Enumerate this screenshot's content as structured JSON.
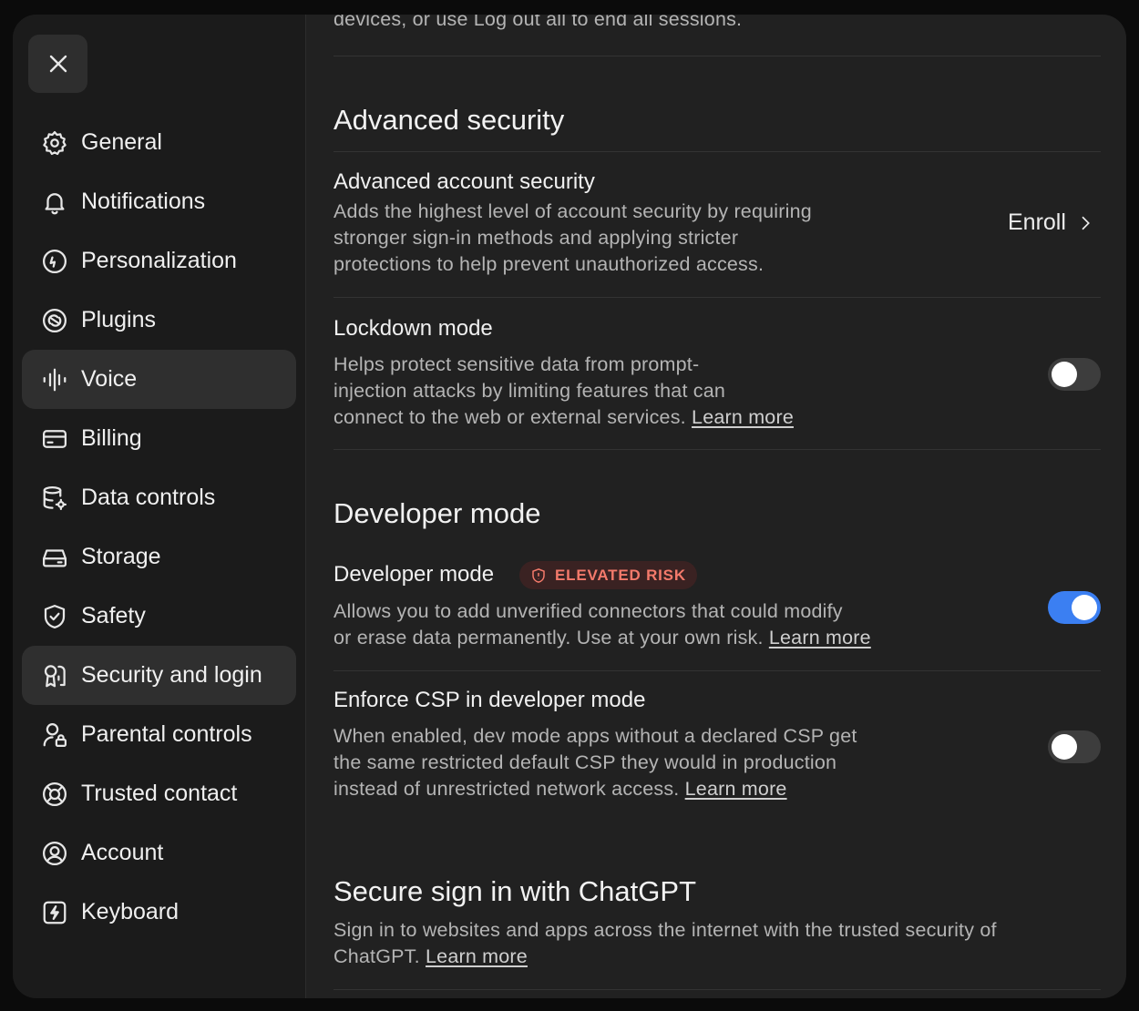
{
  "sidebar": {
    "items": [
      {
        "label": "General",
        "icon": "gear-icon",
        "active": false
      },
      {
        "label": "Notifications",
        "icon": "bell-icon",
        "active": false
      },
      {
        "label": "Personalization",
        "icon": "personalization-icon",
        "active": false
      },
      {
        "label": "Plugins",
        "icon": "plugins-icon",
        "active": false
      },
      {
        "label": "Voice",
        "icon": "waveform-icon",
        "active": true
      },
      {
        "label": "Billing",
        "icon": "credit-card-icon",
        "active": false
      },
      {
        "label": "Data controls",
        "icon": "database-gear-icon",
        "active": false
      },
      {
        "label": "Storage",
        "icon": "hard-drive-icon",
        "active": false
      },
      {
        "label": "Safety",
        "icon": "shield-check-icon",
        "active": false
      },
      {
        "label": "Security and login",
        "icon": "key-person-icon",
        "active": true
      },
      {
        "label": "Parental controls",
        "icon": "person-lock-icon",
        "active": false
      },
      {
        "label": "Trusted contact",
        "icon": "lifebuoy-icon",
        "active": false
      },
      {
        "label": "Account",
        "icon": "user-circle-icon",
        "active": false
      },
      {
        "label": "Keyboard",
        "icon": "keyboard-bolt-icon",
        "active": false
      }
    ]
  },
  "content": {
    "top_text": "devices, or use Log out all to end all sessions.",
    "advanced_security": {
      "title": "Advanced security",
      "account": {
        "title": "Advanced account security",
        "desc_lines": [
          "Adds the highest level of account security by requiring",
          "stronger sign-in methods and applying stricter",
          "protections to help prevent unauthorized access."
        ],
        "action": "Enroll"
      },
      "lockdown": {
        "title": "Lockdown mode",
        "desc_lines": [
          "Helps protect sensitive data from prompt-",
          "injection attacks by limiting features that can",
          "connect to the web or external services."
        ],
        "link": "Learn more",
        "enabled": false
      }
    },
    "developer": {
      "title": "Developer mode",
      "mode": {
        "title": "Developer mode",
        "badge": "ELEVATED RISK",
        "desc_lines": [
          "Allows you to add unverified connectors that could modify",
          "or erase data permanently. Use at your own risk."
        ],
        "link": "Learn more",
        "enabled": true
      },
      "csp": {
        "title": "Enforce CSP in developer mode",
        "desc_lines": [
          "When enabled, dev mode apps without a declared CSP get",
          "the same restricted default CSP they would in production",
          "instead of unrestricted network access."
        ],
        "link": "Learn more",
        "enabled": false
      }
    },
    "secure_signin": {
      "title": "Secure sign in with ChatGPT",
      "desc_lines": [
        "Sign in to websites and apps across the internet with the trusted security of",
        "ChatGPT."
      ],
      "link": "Learn more"
    }
  },
  "colors": {
    "background": "#212121",
    "sidebar": "#1b1b1b",
    "active_item": "#2f2f2f",
    "toggle_on": "#3b7ff2",
    "toggle_off": "#3d3d3d",
    "risk": "#f47a6b"
  }
}
